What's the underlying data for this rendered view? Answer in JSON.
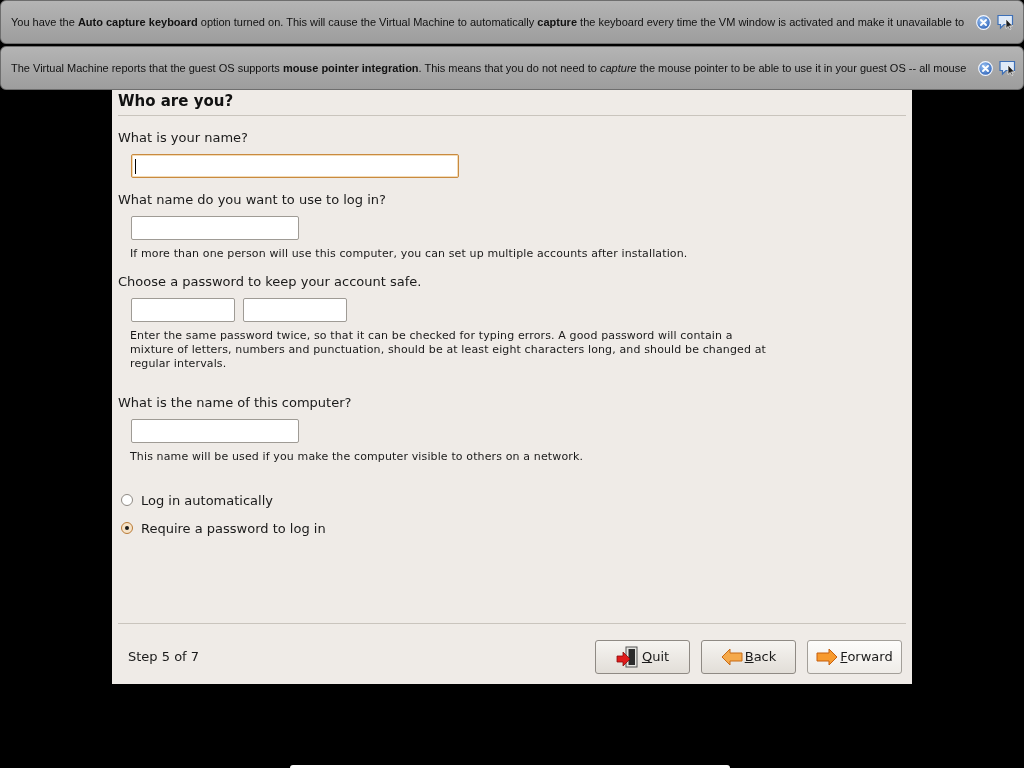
{
  "notifications": [
    {
      "text": "You have the **Auto capture keyboard** option turned on. This will cause the Virtual Machine to automatically **capture** the keyboard every time the VM window is activated and make it unavailable to"
    },
    {
      "text": "The Virtual Machine reports that the guest OS supports **mouse pointer integration**. This means that you do not need to *capture* the mouse pointer to be able to use it in your guest OS -- all mouse"
    }
  ],
  "installer": {
    "heading": "Who are you?",
    "sections": [
      {
        "label": "What is your name?",
        "inputs": [
          {
            "focused": true
          }
        ]
      },
      {
        "label": "What name do you want to use to log in?",
        "inputs": [
          {
            "focused": false
          }
        ],
        "hint": "If more than one person will use this computer, you can set up multiple accounts after installation."
      },
      {
        "label": "Choose a password to keep your account safe.",
        "inputs": [
          {
            "focused": false
          },
          {
            "focused": false
          }
        ],
        "hint": "Enter the same password twice, so that it can be checked for typing errors. A good password will contain a mixture of letters, numbers and punctuation, should be at least eight characters long, and should be changed at regular intervals."
      },
      {
        "label": "What is the name of this computer?",
        "inputs": [
          {
            "focused": false
          }
        ],
        "hint": "This name will be used if you make the computer visible to others on a network."
      }
    ],
    "login_options": [
      {
        "label": "Log in automatically",
        "selected": false
      },
      {
        "label": "Require a password to log in",
        "selected": true
      }
    ],
    "step": "Step 5 of 7",
    "buttons": [
      {
        "label": "Quit",
        "kind": "quit",
        "hovered": false
      },
      {
        "label": "Back",
        "kind": "back",
        "hovered": false
      },
      {
        "label": "Forward",
        "kind": "forward",
        "hovered": true
      }
    ]
  }
}
